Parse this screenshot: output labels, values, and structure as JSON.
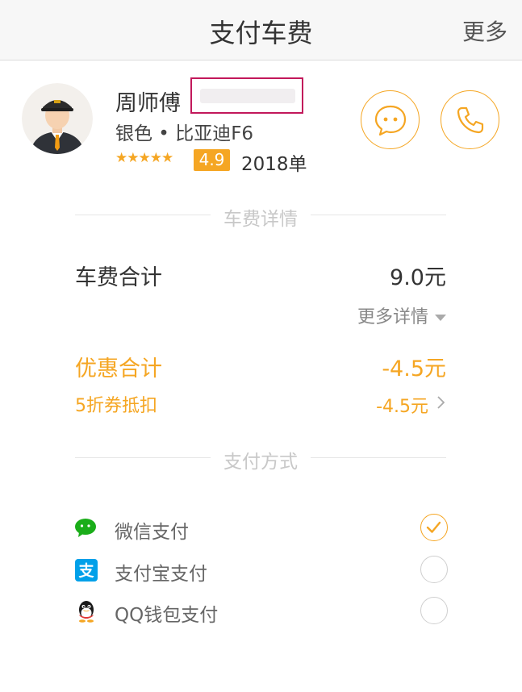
{
  "header": {
    "title": "支付车费",
    "more": "更多"
  },
  "driver": {
    "name": "周师傅",
    "car": "银色 • 比亚迪F6",
    "stars": "★★★★★",
    "rating": "4.9",
    "orders": "2018单"
  },
  "fare_section": {
    "divider": "车费详情"
  },
  "fare": {
    "total_label": "车费合计",
    "total_value": "9.0元",
    "more_details": "更多详情",
    "discount_label": "优惠合计",
    "discount_value": "-4.5元",
    "coupon_label": "5折券抵扣",
    "coupon_value": "-4.5元"
  },
  "payment_section": {
    "divider": "支付方式"
  },
  "payment_methods": [
    {
      "label": "微信支付",
      "icon": "wechat-icon",
      "selected": true
    },
    {
      "label": "支付宝支付",
      "icon": "alipay-icon",
      "selected": false
    },
    {
      "label": "QQ钱包支付",
      "icon": "qq-icon",
      "selected": false
    }
  ],
  "colors": {
    "accent": "#f5a623",
    "wechat": "#1aad19",
    "alipay": "#00a0e9",
    "highlight_box": "#c2185b"
  }
}
